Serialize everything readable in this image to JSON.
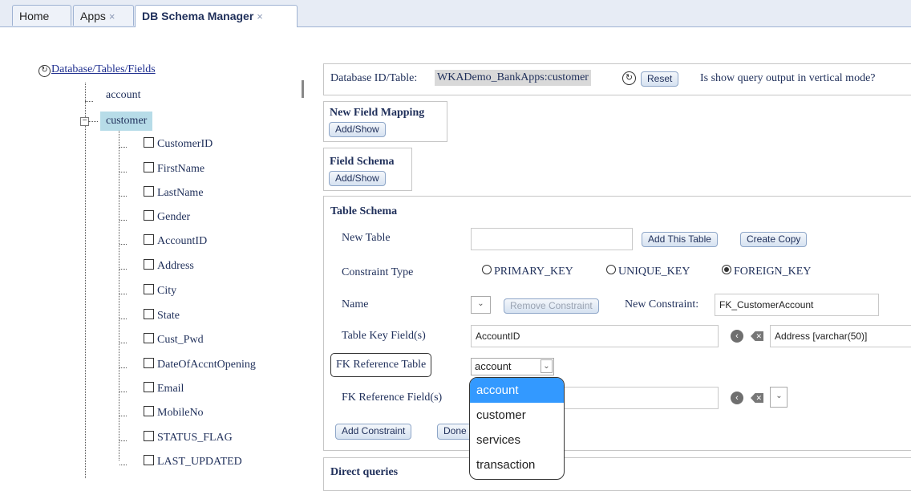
{
  "tabs": [
    {
      "label": "Home",
      "closable": false
    },
    {
      "label": "Apps",
      "closable": true
    },
    {
      "label": "DB Schema Manager",
      "closable": true
    }
  ],
  "tab_close_glyph": "×",
  "tree": {
    "root_label": "Database/Tables/Fields",
    "tables": [
      {
        "label": "account"
      },
      {
        "label": "customer",
        "selected": true,
        "expanded": true
      }
    ],
    "fields": [
      "CustomerID",
      "FirstName",
      "LastName",
      "Gender",
      "AccountID",
      "Address",
      "City",
      "State",
      "Cust_Pwd",
      "DateOfAccntOpening",
      "Email",
      "MobileNo",
      "STATUS_FLAG",
      "LAST_UPDATED"
    ]
  },
  "header": {
    "label": "Database ID/Table:",
    "value": "WKADemo_BankApps:customer",
    "reset_label": "Reset",
    "vertical_mode_label": "Is show query output in vertical mode?"
  },
  "new_field_mapping": {
    "title": "New Field Mapping",
    "button": "Add/Show"
  },
  "field_schema": {
    "title": "Field Schema",
    "button": "Add/Show"
  },
  "table_schema": {
    "title": "Table Schema",
    "new_table_label": "New Table",
    "new_table_value": "",
    "add_table_button": "Add This Table",
    "create_copy_button": "Create Copy",
    "constraint_type_label": "Constraint Type",
    "constraint_types": [
      "PRIMARY_KEY",
      "UNIQUE_KEY",
      "FOREIGN_KEY"
    ],
    "constraint_selected": "FOREIGN_KEY",
    "name_label": "Name",
    "remove_constraint_button": "Remove Constraint",
    "new_constraint_label": "New Constraint:",
    "new_constraint_value": "FK_CustomerAccount",
    "table_key_fields_label": "Table Key Field(s)",
    "table_key_fields_value": "AccountID",
    "key_field_select_value": "Address [varchar(50)]",
    "fk_ref_table_label": "FK Reference Table",
    "fk_ref_table_value": "account",
    "fk_ref_field_label": "FK Reference Field(s)",
    "fk_ref_field_value": "",
    "add_constraint_button": "Add Constraint",
    "done_button": "Done"
  },
  "fk_table_options": [
    "account",
    "customer",
    "services",
    "transaction"
  ],
  "fk_table_highlighted": "account",
  "direct_queries_title": "Direct queries",
  "icons": {
    "refresh": "↻",
    "back": "‹",
    "clear": "✕",
    "chevron": "⌄",
    "tree_collapse": "−"
  },
  "colors": {
    "highlight": "#3399ff",
    "selected_node": "#b7dce8",
    "text": "#1f2f5a"
  }
}
